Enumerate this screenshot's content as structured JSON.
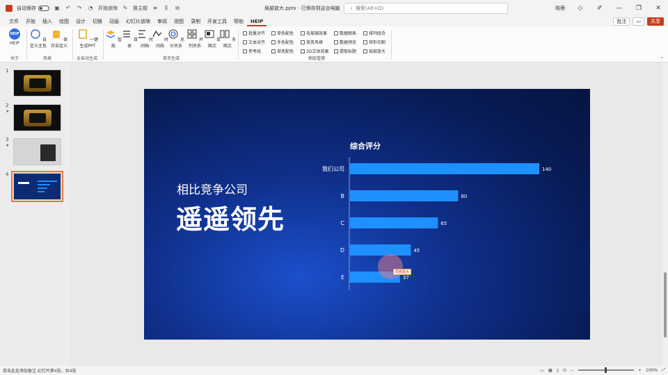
{
  "titlebar": {
    "autosave": "自动保存",
    "present": "开始放映",
    "theme_label": "换主题",
    "doc_title": "局部放大.pptx · 已保存到这台电脑",
    "search_placeholder": "搜索(Alt+Q)",
    "user": "晓蓓",
    "minimize": "—",
    "restore": "❐",
    "close": "✕"
  },
  "tabs": [
    {
      "label": "文件"
    },
    {
      "label": "开始"
    },
    {
      "label": "插入"
    },
    {
      "label": "绘图"
    },
    {
      "label": "设计"
    },
    {
      "label": "切换"
    },
    {
      "label": "动画"
    },
    {
      "label": "幻灯片放映"
    },
    {
      "label": "审阅"
    },
    {
      "label": "视图"
    },
    {
      "label": "录制"
    },
    {
      "label": "开发工具"
    },
    {
      "label": "帮助"
    },
    {
      "label": "HEIP"
    }
  ],
  "tab_actions": {
    "comment": "批注",
    "present": "▭",
    "share": "共享"
  },
  "ribbon": {
    "help_logo": "HEIP",
    "items": [
      {
        "label": "HEIP"
      },
      {
        "label": "自定义主色"
      },
      {
        "label": "保存自定义"
      },
      {
        "label": "一键生成PPT"
      },
      {
        "label": "智能"
      },
      {
        "label": "目录"
      },
      {
        "label": "时间轴"
      },
      {
        "label": "时间线"
      },
      {
        "label": "总分关系"
      },
      {
        "label": "并列关系"
      },
      {
        "label": "单图文"
      },
      {
        "label": "多图文"
      }
    ],
    "groups": [
      "关于",
      "风格",
      "全自动生成",
      "单页生成",
      "图层管理"
    ],
    "checks": [
      "批量对齐",
      "单色配色",
      "毛玻璃效果",
      "数据图表",
      "排列组合",
      "文本对齐",
      "多色配色",
      "渐变风格",
      "数据预览",
      "矩形切割",
      "参考线",
      "渐变配色",
      "3D立体效果",
      "提取标题",
      "局部放大"
    ]
  },
  "thumbs": [
    {
      "num": "1",
      "star": ""
    },
    {
      "num": "2",
      "star": "★"
    },
    {
      "num": "3",
      "star": "★"
    },
    {
      "num": "4",
      "star": ""
    }
  ],
  "slide": {
    "subtitle": "相比竞争公司",
    "title": "遥遥领先",
    "tooltip": "局部放大"
  },
  "chart_data": {
    "type": "bar",
    "orientation": "horizontal",
    "title": "综合评分",
    "categories": [
      "我们公司",
      "B",
      "C",
      "D",
      "E"
    ],
    "values": [
      140,
      80,
      65,
      45,
      37
    ],
    "xlim": [
      0,
      140
    ],
    "grid": false,
    "legend": "none",
    "bar_color": "#1e90ff"
  },
  "status": {
    "left": "单击此处添加备注  幻灯片第4张，共4张",
    "zoom": "100%"
  }
}
